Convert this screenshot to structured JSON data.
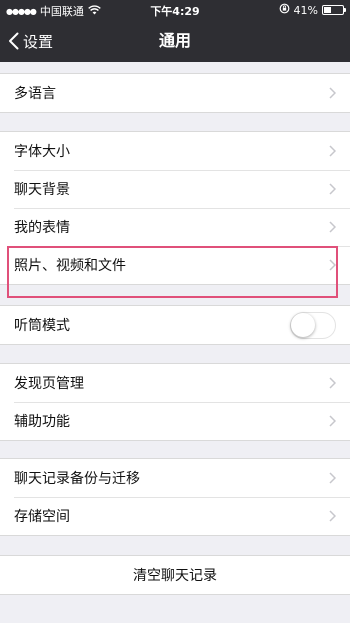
{
  "status_bar": {
    "carrier": "中国联通",
    "time": "下午4:29",
    "battery_text": "41%",
    "battery_level": 0.41
  },
  "nav": {
    "back_label": "设置",
    "title": "通用"
  },
  "groups": [
    {
      "items": [
        {
          "label": "多语言",
          "accessory": "chevron"
        }
      ]
    },
    {
      "items": [
        {
          "label": "字体大小",
          "accessory": "chevron"
        },
        {
          "label": "聊天背景",
          "accessory": "chevron"
        },
        {
          "label": "我的表情",
          "accessory": "chevron"
        },
        {
          "label": "照片、视频和文件",
          "accessory": "chevron"
        }
      ]
    },
    {
      "items": [
        {
          "label": "听筒模式",
          "accessory": "toggle",
          "toggle_on": false
        }
      ]
    },
    {
      "items": [
        {
          "label": "发现页管理",
          "accessory": "chevron"
        },
        {
          "label": "辅助功能",
          "accessory": "chevron"
        }
      ]
    },
    {
      "items": [
        {
          "label": "聊天记录备份与迁移",
          "accessory": "chevron"
        },
        {
          "label": "存储空间",
          "accessory": "chevron"
        }
      ]
    },
    {
      "items": [
        {
          "label": "清空聊天记录",
          "accessory": "none"
        }
      ]
    }
  ],
  "colors": {
    "nav_background": "#2e2e33",
    "page_background": "#efeff4",
    "highlight": "#e0507a"
  },
  "icons": {
    "back": "chevron-left-icon",
    "row": "chevron-right-icon",
    "wifi": "wifi-icon",
    "orientation_lock": "orientation-lock-icon",
    "battery": "battery-icon"
  }
}
